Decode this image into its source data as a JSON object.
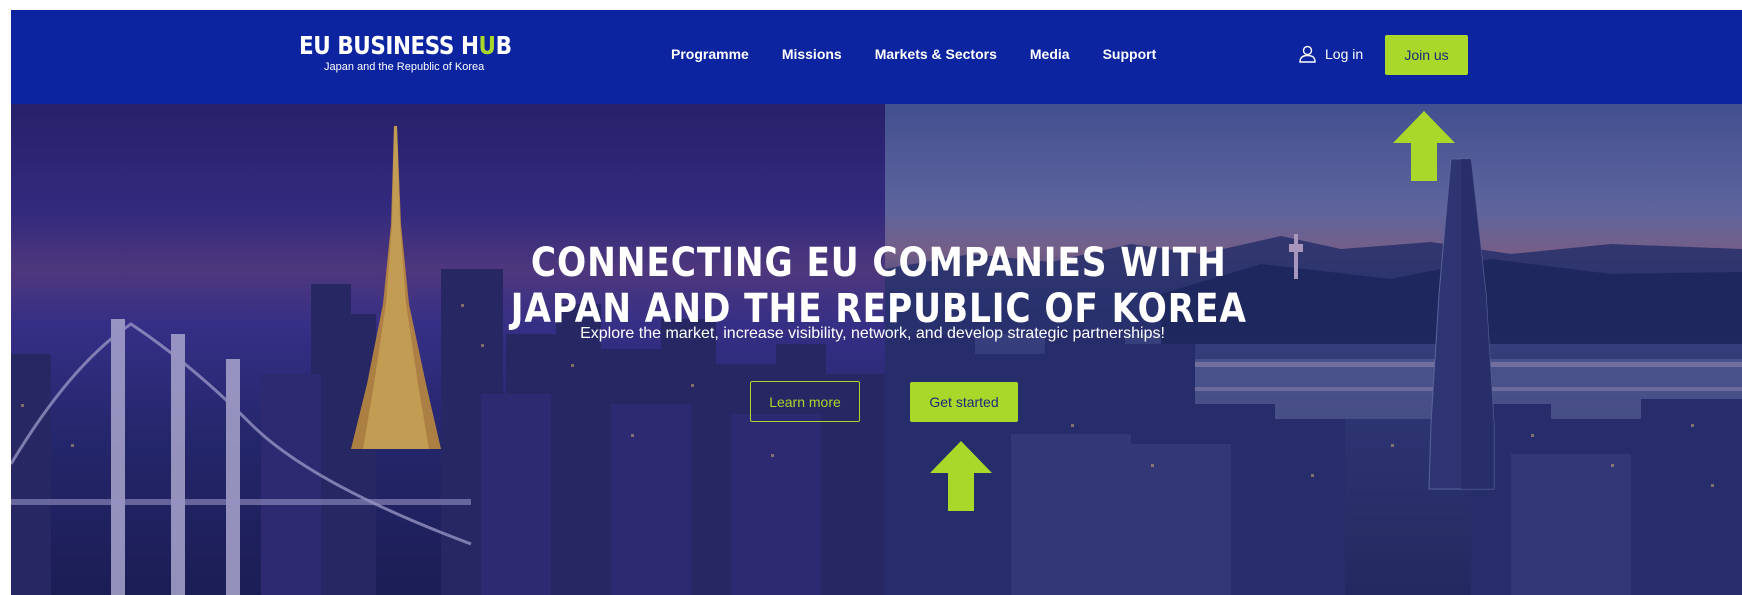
{
  "header": {
    "logo": {
      "main_prefix": "EU BUSINESS H",
      "main_u": "U",
      "main_suffix": "B",
      "subtitle": "Japan and the Republic of Korea"
    },
    "nav": [
      {
        "label": "Programme"
      },
      {
        "label": "Missions"
      },
      {
        "label": "Markets & Sectors"
      },
      {
        "label": "Media"
      },
      {
        "label": "Support"
      }
    ],
    "login_label": "Log in",
    "join_label": "Join us"
  },
  "hero": {
    "title_line1": "CONNECTING EU COMPANIES WITH",
    "title_line2": "JAPAN AND THE REPUBLIC OF KOREA",
    "subtitle": "Explore the market, increase visibility, network, and develop strategic partnerships!",
    "learn_more_label": "Learn more",
    "get_started_label": "Get started"
  },
  "icons": {
    "user": "user-icon",
    "arrow": "arrow-up-icon"
  },
  "colors": {
    "header_bg": "#0c24a0",
    "accent": "#a9d82b",
    "text_light": "#ffffff"
  }
}
